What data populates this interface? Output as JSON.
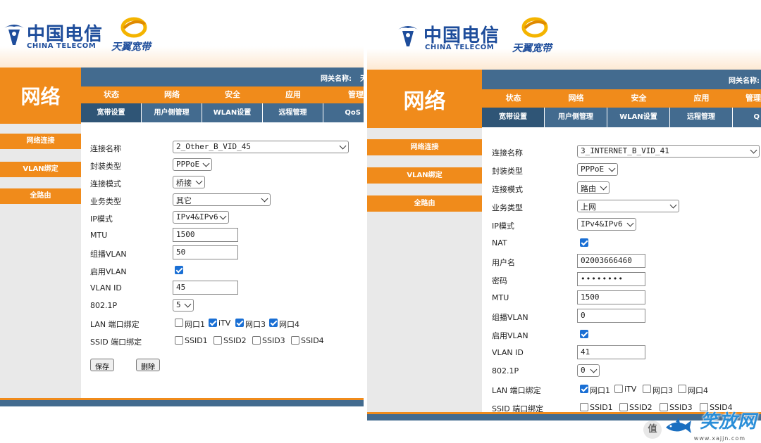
{
  "brand": {
    "ct_cn": "中国电信",
    "ct_en": "CHINA TELECOM",
    "ty_cn": "天翼宽带"
  },
  "colors": {
    "orange": "#f08b1b",
    "blue_bar": "#436b8f",
    "brand_blue": "#1e4d9b",
    "checkbox": "#1a6fd4"
  },
  "left": {
    "title": "网络",
    "gateway_label": "网关名称:",
    "gateway_tail": "天",
    "menu": [
      "状态",
      "网络",
      "安全",
      "应用",
      "管理"
    ],
    "submenu": [
      "宽带设置",
      "用户侧管理",
      "WLAN设置",
      "远程管理",
      "QoS"
    ],
    "side": [
      "网络连接",
      "VLAN绑定",
      "全路由"
    ],
    "form": {
      "conn_name_label": "连接名称",
      "conn_name_value": "2_Other_B_VID_45",
      "encap_label": "封装类型",
      "encap_value": "PPPoE",
      "mode_label": "连接模式",
      "mode_value": "桥接",
      "service_label": "业务类型",
      "service_value": "其它",
      "ip_label": "IP模式",
      "ip_value": "IPv4&IPv6",
      "mtu_label": "MTU",
      "mtu_value": "1500",
      "mcast_label": "组播VLAN",
      "mcast_value": "50",
      "enable_vlan_label": "启用VLAN",
      "vlanid_label": "VLAN ID",
      "vlanid_value": "45",
      "p8021_label": "802.1P",
      "p8021_value": "5",
      "lan_bind_label": "LAN 端口绑定",
      "lan_ports": [
        {
          "label": "网口1",
          "checked": false
        },
        {
          "label": "iTV",
          "checked": true
        },
        {
          "label": "网口3",
          "checked": true
        },
        {
          "label": "网口4",
          "checked": true
        }
      ],
      "ssid_bind_label": "SSID 端口绑定",
      "ssids": [
        {
          "label": "SSID1",
          "checked": false
        },
        {
          "label": "SSID2",
          "checked": false
        },
        {
          "label": "SSID3",
          "checked": false
        },
        {
          "label": "SSID4",
          "checked": false
        }
      ],
      "save_label": "保存",
      "delete_label": "删除"
    }
  },
  "right": {
    "title": "网络",
    "gateway_label": "网关名称:",
    "menu": [
      "状态",
      "网络",
      "安全",
      "应用",
      "管理"
    ],
    "submenu": [
      "宽带设置",
      "用户侧管理",
      "WLAN设置",
      "远程管理",
      "Q"
    ],
    "side": [
      "网络连接",
      "VLAN绑定",
      "全路由"
    ],
    "form": {
      "conn_name_label": "连接名称",
      "conn_name_value": "3_INTERNET_B_VID_41",
      "encap_label": "封装类型",
      "encap_value": "PPPoE",
      "mode_label": "连接模式",
      "mode_value": "路由",
      "service_label": "业务类型",
      "service_value": "上网",
      "ip_label": "IP模式",
      "ip_value": "IPv4&IPv6",
      "nat_label": "NAT",
      "user_label": "用户名",
      "user_value": "02003666460",
      "pass_label": "密码",
      "pass_value": "••••••••",
      "mtu_label": "MTU",
      "mtu_value": "1500",
      "mcast_label": "组播VLAN",
      "mcast_value": "0",
      "enable_vlan_label": "启用VLAN",
      "vlanid_label": "VLAN ID",
      "vlanid_value": "41",
      "p8021_label": "802.1P",
      "p8021_value": "0",
      "lan_bind_label": "LAN 端口绑定",
      "lan_ports": [
        {
          "label": "网口1",
          "checked": true
        },
        {
          "label": "iTV",
          "checked": false
        },
        {
          "label": "网口3",
          "checked": false
        },
        {
          "label": "网口4",
          "checked": false
        }
      ],
      "ssid_bind_label": "SSID 端口绑定",
      "ssids": [
        {
          "label": "SSID1",
          "checked": false
        },
        {
          "label": "SSID2",
          "checked": false
        },
        {
          "label": "SSID3",
          "checked": false
        },
        {
          "label": "SSID4",
          "checked": false
        }
      ]
    }
  },
  "watermark": {
    "badge": "值",
    "text": "笑放网",
    "url": "www.xajjn.com"
  }
}
